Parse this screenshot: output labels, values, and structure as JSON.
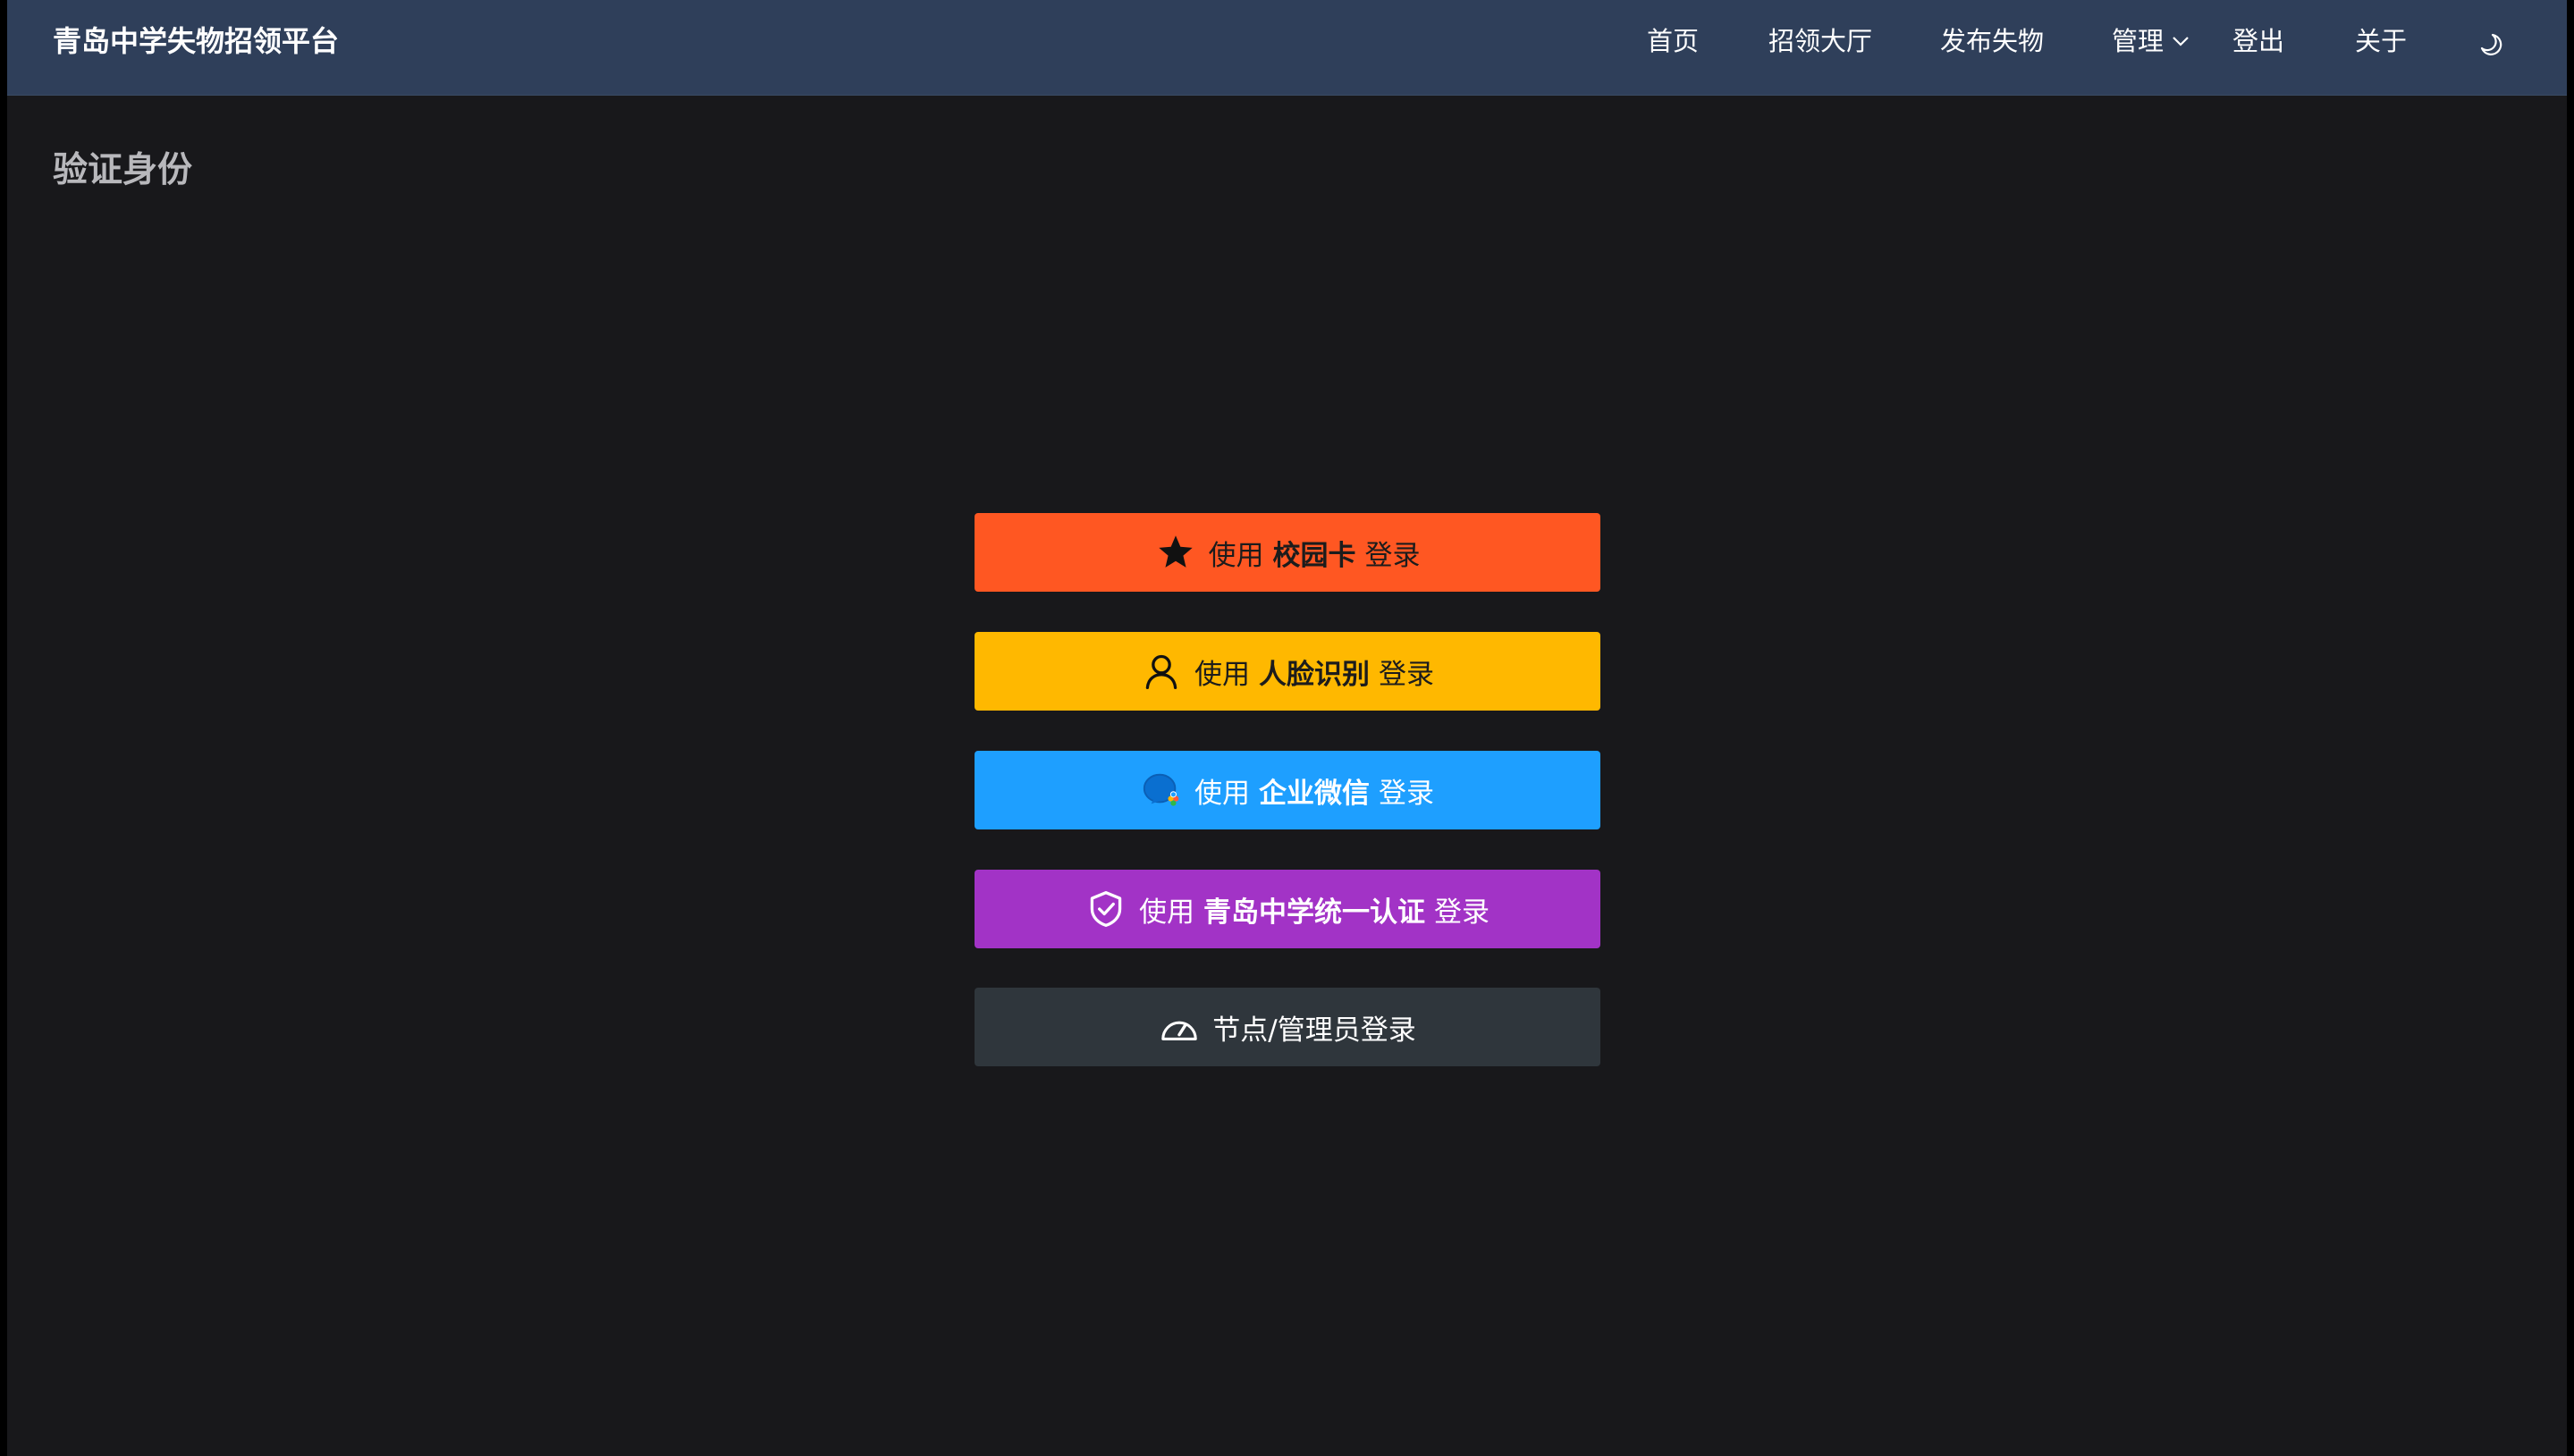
{
  "navbar": {
    "brand": "青岛中学失物招领平台",
    "items": [
      {
        "label": "首页"
      },
      {
        "label": "招领大厅"
      },
      {
        "label": "发布失物"
      },
      {
        "label": "管理"
      },
      {
        "label": "登出"
      },
      {
        "label": "关于"
      }
    ],
    "theme_toggle_icon": "moon-icon"
  },
  "page": {
    "title": "验证身份"
  },
  "login_options": [
    {
      "prefix": "使用",
      "method": "校园卡",
      "suffix": "登录",
      "icon": "star-icon",
      "color": "#ff5722"
    },
    {
      "prefix": "使用",
      "method": "人脸识别",
      "suffix": "登录",
      "icon": "user-icon",
      "color": "#ffb800"
    },
    {
      "prefix": "使用",
      "method": "企业微信",
      "suffix": "登录",
      "icon": "wecom-icon",
      "color": "#1e9fff"
    },
    {
      "prefix": "使用",
      "method": "青岛中学统一认证",
      "suffix": "登录",
      "icon": "shield-check-icon",
      "color": "#a233c6"
    },
    {
      "label": "节点/管理员登录",
      "icon": "dashboard-icon",
      "color": "#2f363c"
    }
  ]
}
